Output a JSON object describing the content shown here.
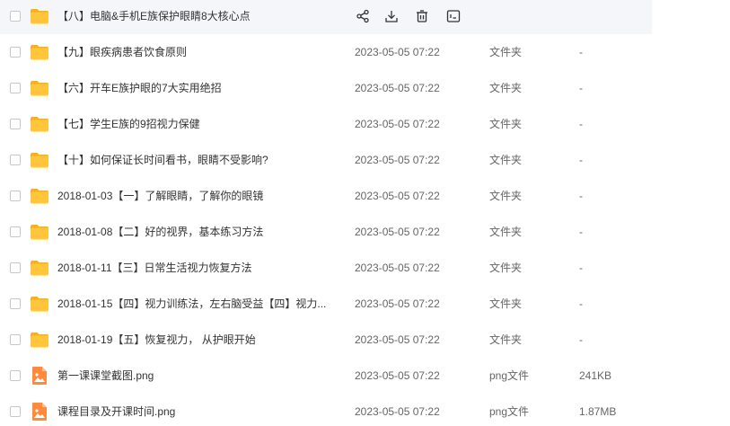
{
  "colors": {
    "folder": "#FFC53D",
    "folder_tab": "#F5B21A",
    "image_file": "#FF8A3D",
    "row_hover": "#F5F6FA",
    "action_icon": "#333333"
  },
  "row_actions": [
    {
      "icon": "share-icon"
    },
    {
      "icon": "download-icon"
    },
    {
      "icon": "delete-icon"
    },
    {
      "icon": "rename-icon"
    }
  ],
  "files": [
    {
      "icon": "folder-icon",
      "name": "【八】电脑&手机E族保护眼睛8大核心点",
      "date": "",
      "type": "",
      "size": "",
      "hovered": true
    },
    {
      "icon": "folder-icon",
      "name": "【九】眼疾病患者饮食原则",
      "date": "2023-05-05 07:22",
      "type": "文件夹",
      "size": "-"
    },
    {
      "icon": "folder-icon",
      "name": "【六】开车E族护眼的7大实用绝招",
      "date": "2023-05-05 07:22",
      "type": "文件夹",
      "size": "-"
    },
    {
      "icon": "folder-icon",
      "name": "【七】学生E族的9招视力保健",
      "date": "2023-05-05 07:22",
      "type": "文件夹",
      "size": "-"
    },
    {
      "icon": "folder-icon",
      "name": "【十】如何保证长时间看书，眼睛不受影响?",
      "date": "2023-05-05 07:22",
      "type": "文件夹",
      "size": "-"
    },
    {
      "icon": "folder-icon",
      "name": "2018-01-03【一】了解眼睛，了解你的眼镜",
      "date": "2023-05-05 07:22",
      "type": "文件夹",
      "size": "-"
    },
    {
      "icon": "folder-icon",
      "name": "2018-01-08【二】好的视界，基本练习方法",
      "date": "2023-05-05 07:22",
      "type": "文件夹",
      "size": "-"
    },
    {
      "icon": "folder-icon",
      "name": "2018-01-11【三】日常生活视力恢复方法",
      "date": "2023-05-05 07:22",
      "type": "文件夹",
      "size": "-"
    },
    {
      "icon": "folder-icon",
      "name": "2018-01-15【四】视力训练法，左右脑受益【四】视力...",
      "date": "2023-05-05 07:22",
      "type": "文件夹",
      "size": "-"
    },
    {
      "icon": "folder-icon",
      "name": "2018-01-19【五】恢复视力， 从护眼开始",
      "date": "2023-05-05 07:22",
      "type": "文件夹",
      "size": "-"
    },
    {
      "icon": "image-file-icon",
      "name": "第一课课堂截图.png",
      "date": "2023-05-05 07:22",
      "type": "png文件",
      "size": "241KB"
    },
    {
      "icon": "image-file-icon",
      "name": "课程目录及开课时间.png",
      "date": "2023-05-05 07:22",
      "type": "png文件",
      "size": "1.87MB"
    }
  ]
}
